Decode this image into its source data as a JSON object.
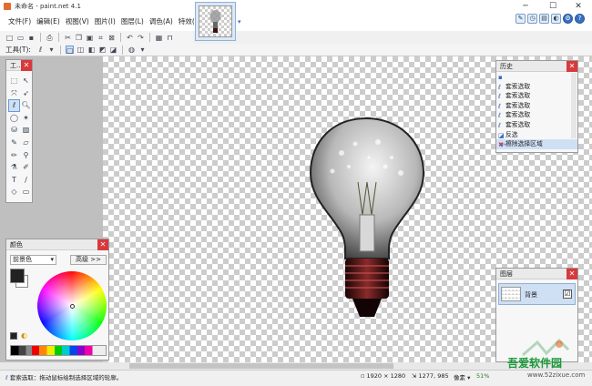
{
  "window": {
    "title": "未命名 - paint.net 4.1",
    "controls": {
      "minimize": "─",
      "maximize": "☐",
      "close": "✕"
    }
  },
  "menu": {
    "items": [
      "文件(F)",
      "编辑(E)",
      "视图(V)",
      "图片(I)",
      "图层(L)",
      "调色(A)",
      "特效(C)"
    ]
  },
  "toolbar": {
    "tool_label": "工具(T):"
  },
  "tools_panel": {
    "title": "工...",
    "close": "✕"
  },
  "colors_panel": {
    "title": "颜色",
    "close": "✕",
    "primary_select": "前景色",
    "more_button": "高级 >>"
  },
  "history_panel": {
    "title": "历史",
    "close": "✕",
    "items": [
      {
        "label": "",
        "state": "normal"
      },
      {
        "label": "套索选取",
        "state": "normal"
      },
      {
        "label": "套索选取",
        "state": "normal"
      },
      {
        "label": "套索选取",
        "state": "normal"
      },
      {
        "label": "套索选取",
        "state": "normal"
      },
      {
        "label": "套索选取",
        "state": "normal"
      },
      {
        "label": "反选",
        "state": "normal"
      },
      {
        "label": "擦除选择区域",
        "state": "selected"
      }
    ]
  },
  "layers_panel": {
    "title": "图层",
    "close": "✕",
    "layers": [
      {
        "name": "背景",
        "visible": "☑"
      }
    ]
  },
  "status": {
    "text": "套索选取：拖动鼠标绘制选择区域的轮廓。",
    "image_size": "1920 × 1280",
    "cursor": "1277, 985",
    "unit": "像素",
    "zoom": "51%"
  },
  "watermark": {
    "brand": "吾爱软件园",
    "url": "www.52zixue.com"
  },
  "colors": {
    "accent": "#3b6cc4",
    "close": "#d9393b",
    "selection": "#cfe0f5"
  }
}
